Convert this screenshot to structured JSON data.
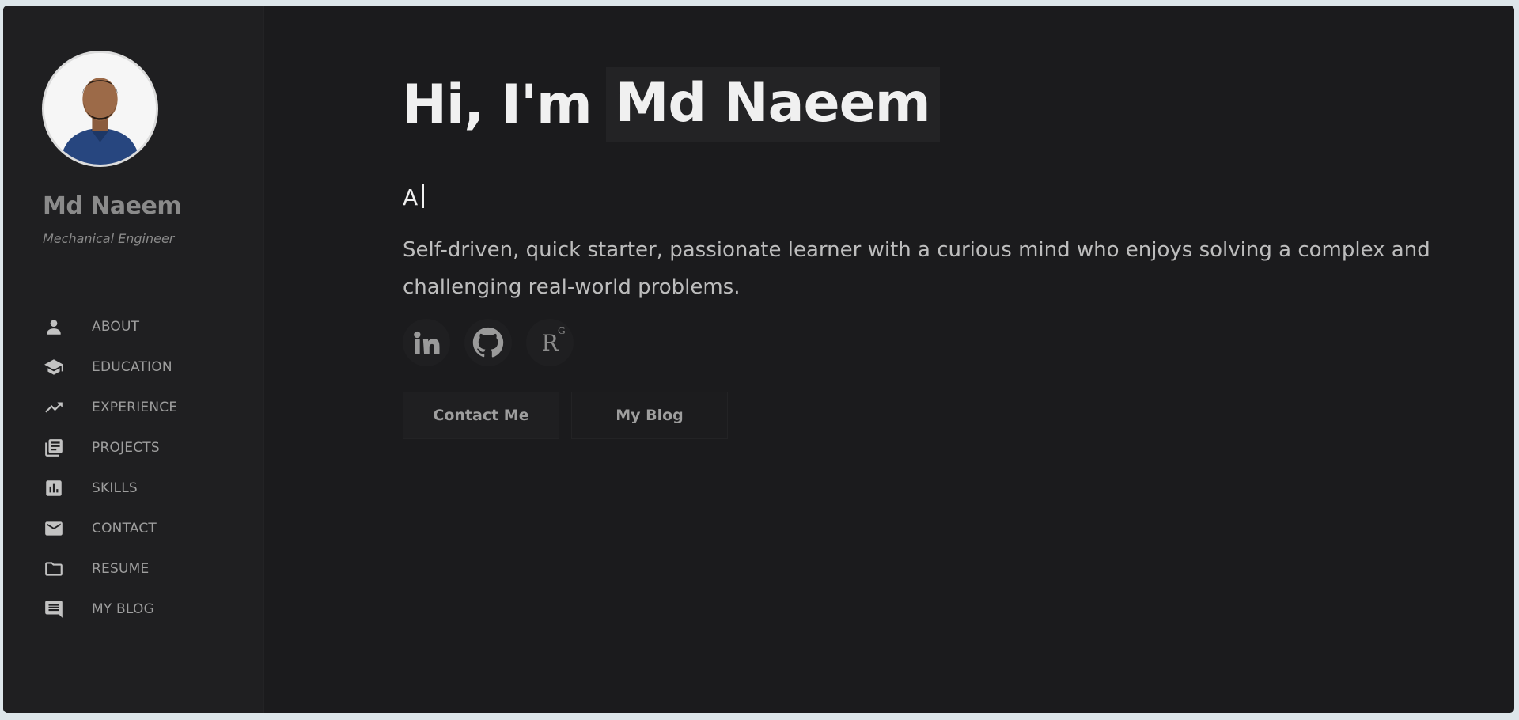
{
  "profile": {
    "name": "Md Naeem",
    "title": "Mechanical Engineer"
  },
  "nav": {
    "items": [
      {
        "label": "ABOUT",
        "icon": "person-icon"
      },
      {
        "label": "EDUCATION",
        "icon": "graduation-cap-icon"
      },
      {
        "label": "EXPERIENCE",
        "icon": "trending-up-icon"
      },
      {
        "label": "PROJECTS",
        "icon": "library-books-icon"
      },
      {
        "label": "SKILLS",
        "icon": "bar-chart-icon"
      },
      {
        "label": "CONTACT",
        "icon": "mail-icon"
      },
      {
        "label": "RESUME",
        "icon": "folder-icon"
      },
      {
        "label": "MY BLOG",
        "icon": "comment-icon"
      }
    ]
  },
  "hero": {
    "greeting": "Hi, I'm",
    "name": "Md Naeem",
    "typed_text": "A",
    "bio": "Self-driven, quick starter, passionate learner with a curious mind who enjoys solving a complex and challenging real-world problems."
  },
  "socials": {
    "linkedin_icon": "linkedin-icon",
    "github_icon": "github-icon",
    "researchgate_icon": "researchgate-icon",
    "researchgate_text": "R",
    "researchgate_sup": "G"
  },
  "buttons": {
    "contact": "Contact Me",
    "blog": "My Blog"
  },
  "colors": {
    "background": "#1b1b1d",
    "sidebar": "#1f1f21",
    "text_primary": "#f0f0f0",
    "text_muted": "#9e9e9e"
  }
}
